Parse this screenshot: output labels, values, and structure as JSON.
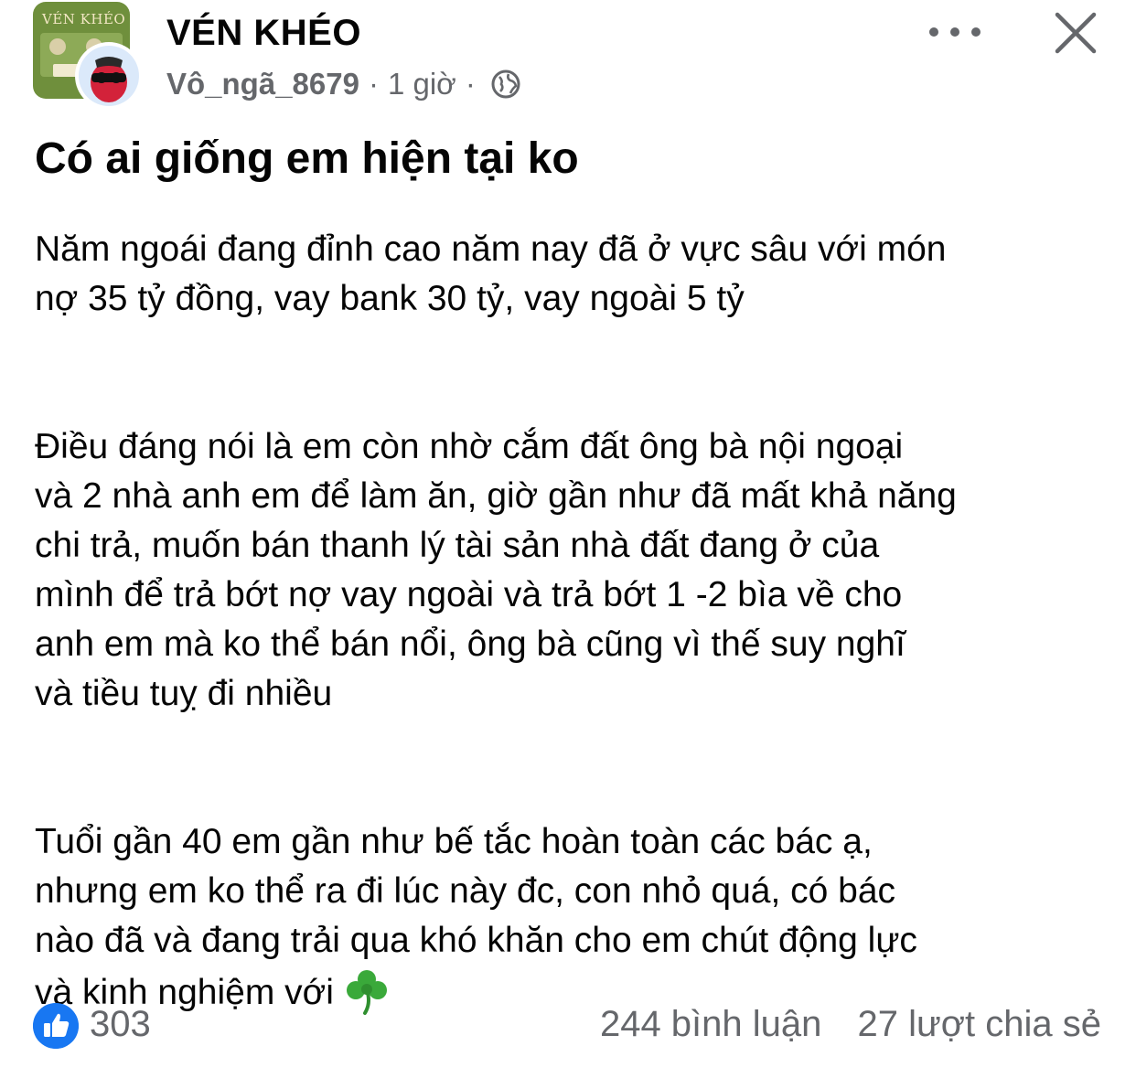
{
  "header": {
    "group_avatar_text": "VÉN KHÉO",
    "group_name": "VÉN KHÉO",
    "author": "Vô_ngã_8679",
    "separator": "·",
    "time": "1 giờ",
    "privacy_icon": "globe-icon",
    "more_icon": "more-icon",
    "close_icon": "close-icon"
  },
  "post": {
    "title": "Có ai giống em hiện tại ko",
    "paragraph1": [
      "Năm ngoái đang đỉnh cao năm nay đã ở vực sâu với món",
      "nợ 35 tỷ đồng, vay bank 30 tỷ, vay ngoài 5 tỷ"
    ],
    "paragraph2": [
      "Điều đáng nói là em còn nhờ cắm đất ông bà nội ngoại",
      "và 2 nhà anh em để làm ăn, giờ gần như đã mất khả năng",
      "chi trả, muốn bán thanh lý tài sản nhà đất đang ở của",
      "mình để trả bớt nợ vay ngoài và trả bớt 1 -2 bìa về cho",
      "anh em mà ko thể bán nổi, ông bà cũng vì thế suy nghĩ",
      "và tiều tuỵ đi nhiều"
    ],
    "paragraph3": [
      "Tuổi gần 40 em gần như bế tắc hoàn toàn các bác ạ,",
      "nhưng em ko thể ra đi lúc này đc, con nhỏ quá, có bác",
      "nào đã và đang trải qua khó khăn cho em chút động lực",
      "và kinh nghiệm với"
    ],
    "end_icon": "clover-icon"
  },
  "footer": {
    "like_icon": "like-icon",
    "like_count": "303",
    "comments": "244 bình luận",
    "shares": "27 lượt chia sẻ"
  },
  "colors": {
    "text": "#050505",
    "secondary": "#65676b",
    "like_blue": "#1877f2",
    "clover_green": "#3aa93a"
  }
}
